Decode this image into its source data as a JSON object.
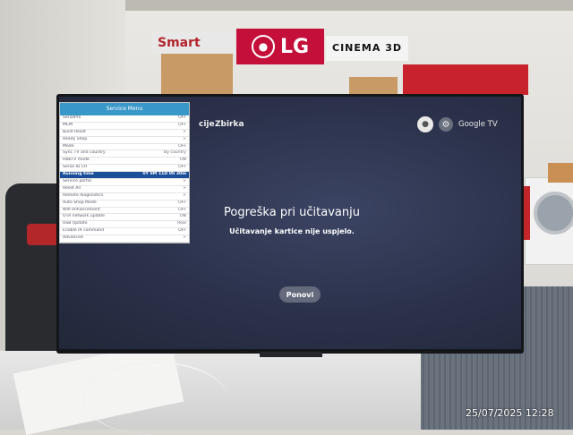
{
  "signs": {
    "smart": "Smart",
    "lg": "LG",
    "cinema": "CINEMA 3D"
  },
  "tv": {
    "tabs": [
      {
        "label": "cije"
      },
      {
        "label": "Zbirka"
      }
    ],
    "brand": "Google TV",
    "error": {
      "title": "Pogreška pri učitavanju",
      "message": "Učitavanje kartice  nije uspjelo.",
      "retry_label": "Ponovi"
    }
  },
  "service_menu": {
    "title": "Service Menu",
    "rows": [
      {
        "label": "SerialPro",
        "value": "OFF"
      },
      {
        "label": "MCM",
        "value": "OFF"
      },
      {
        "label": "Build Reset",
        "value": ">"
      },
      {
        "label": "Ready Shop",
        "value": ">"
      },
      {
        "label": "Mode",
        "value": "OFF"
      },
      {
        "label": "Sync TV and country",
        "value": "By country"
      },
      {
        "label": "HbbTV mode",
        "value": "ON"
      },
      {
        "label": "Serial ID CH",
        "value": "OFF"
      },
      {
        "label": "Running time",
        "value": "0Y 8M 11D 0h 30m",
        "selected": true
      },
      {
        "label": "Service portal",
        "value": ">"
      },
      {
        "label": "Reset All",
        "value": ">"
      },
      {
        "label": "Remote diagnostics",
        "value": ">"
      },
      {
        "label": "Auto Shop Mode",
        "value": "OFF"
      },
      {
        "label": "Wifi enhancement",
        "value": "OFF"
      },
      {
        "label": "OTA network update",
        "value": "ON"
      },
      {
        "label": "USB Update",
        "value": "Real"
      },
      {
        "label": "Enable IR command",
        "value": "OFF"
      },
      {
        "label": "Advanced",
        "value": ">"
      }
    ]
  },
  "timestamp": "25/07/2025 12:28",
  "colors": {
    "menu_title_bg": "#3a98c9",
    "menu_selected_bg": "#1b4f9a",
    "screen_bg": "#2b314a",
    "lg_red": "#c40f3a"
  }
}
